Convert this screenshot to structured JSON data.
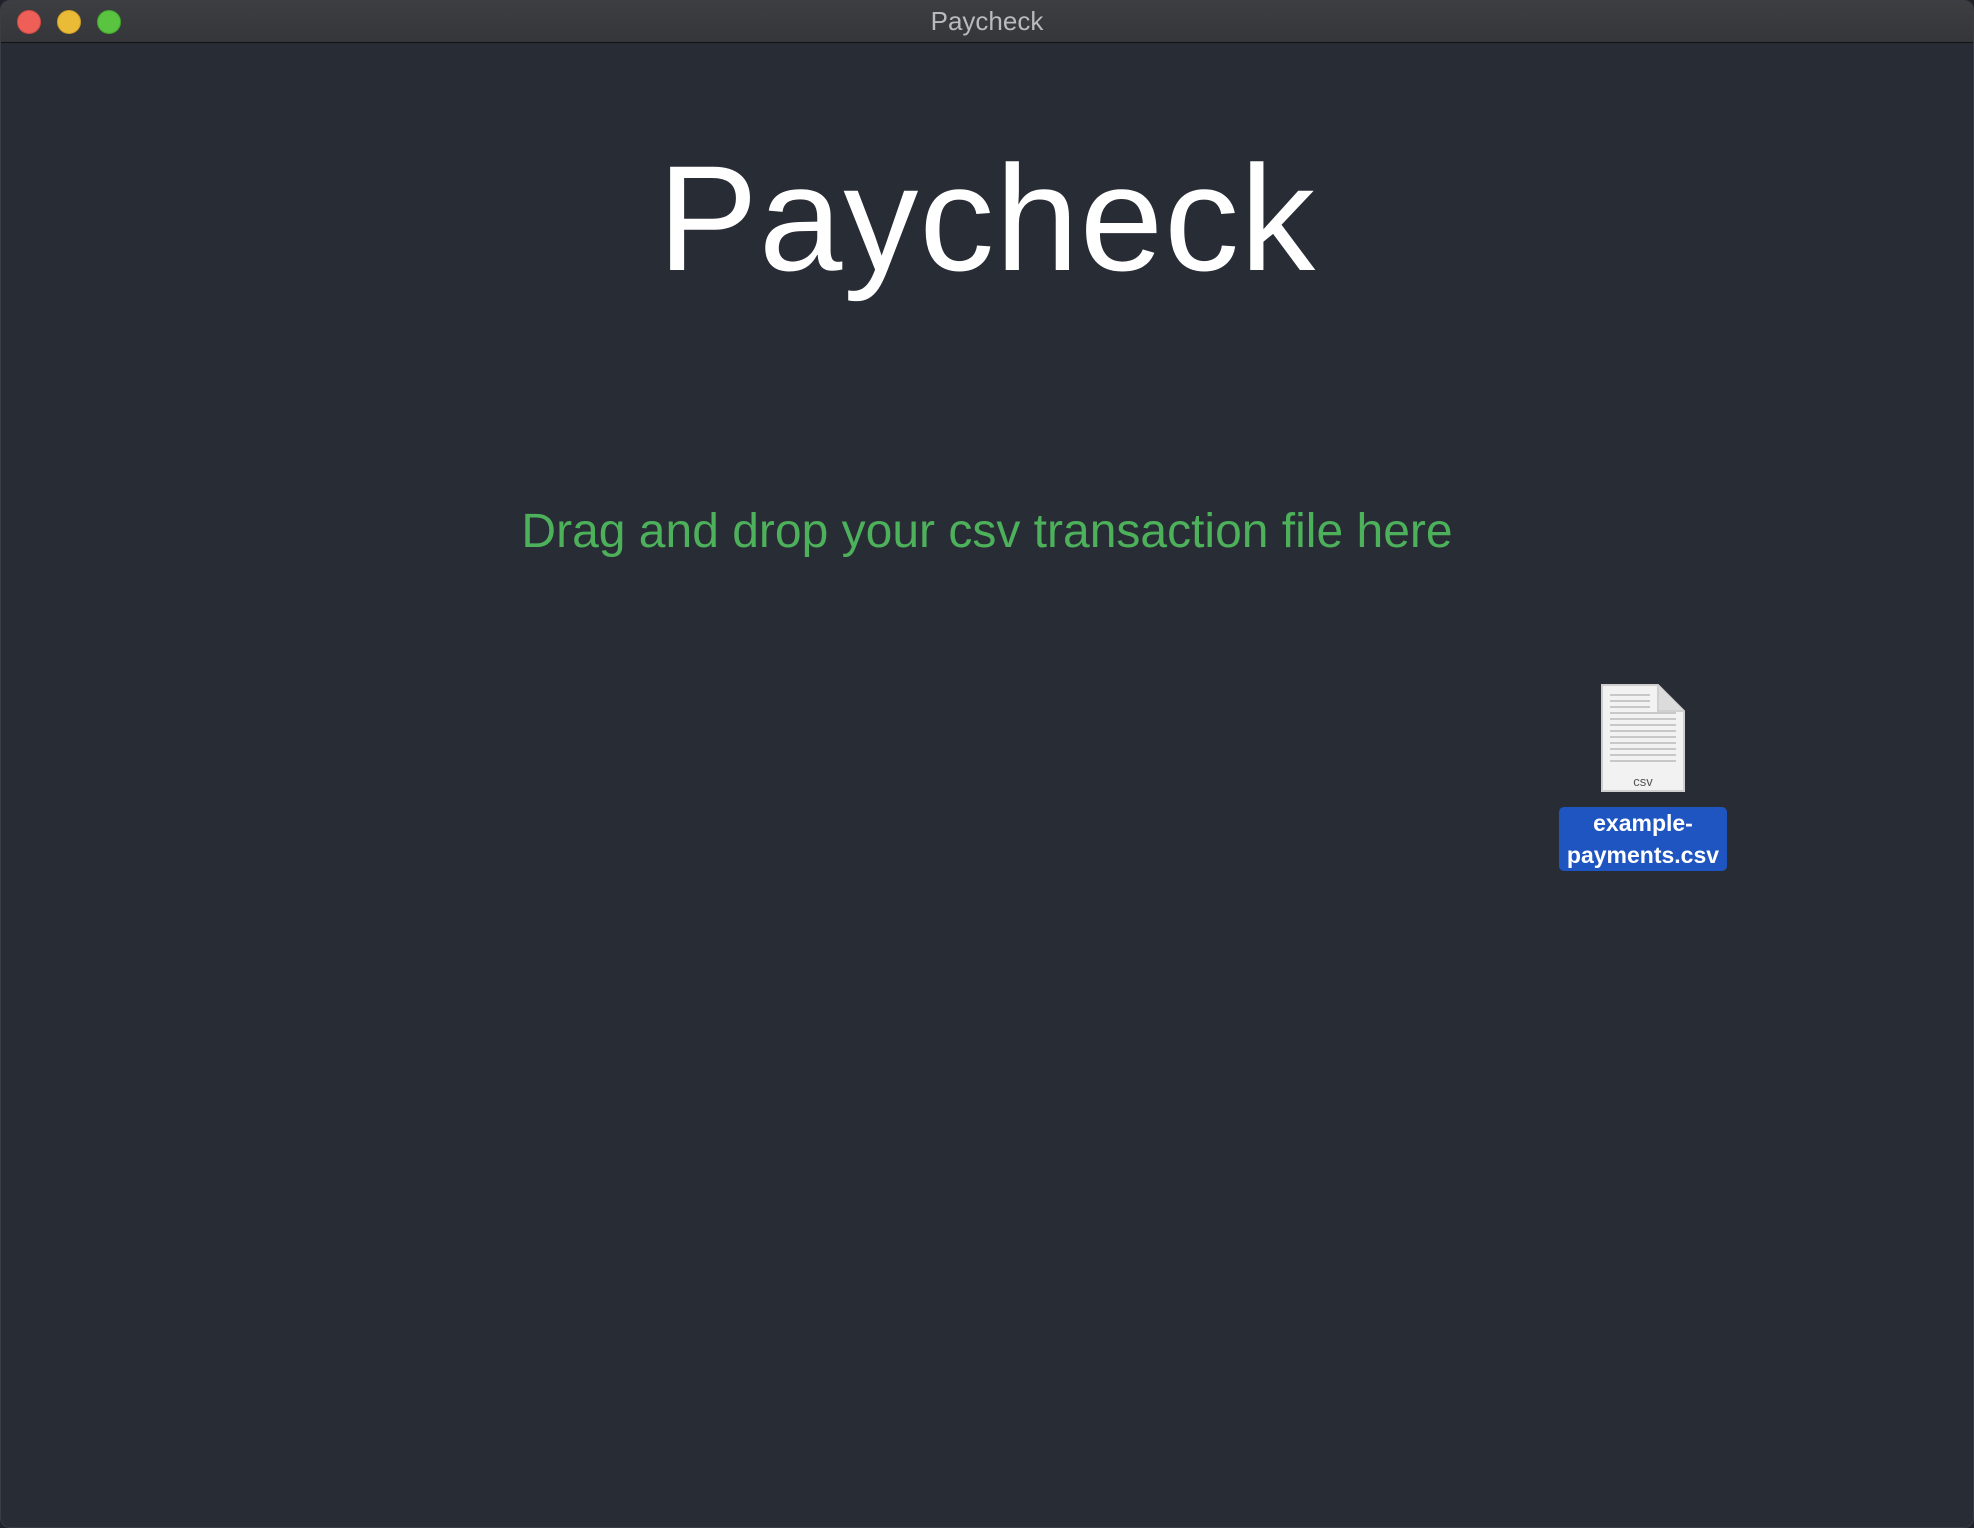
{
  "window": {
    "title": "Paycheck"
  },
  "main": {
    "app_title": "Paycheck",
    "drop_hint": "Drag and drop your csv transaction file here"
  },
  "file": {
    "name_line1": "example-",
    "name_line2": "payments.csv",
    "extension": "csv",
    "icon": "csv-file-icon"
  },
  "colors": {
    "background": "#282c35",
    "hint": "#4db05a",
    "selection": "#1e55c0",
    "close": "#ee5f57",
    "minimize": "#e9bb36",
    "maximize": "#5ac33f"
  }
}
